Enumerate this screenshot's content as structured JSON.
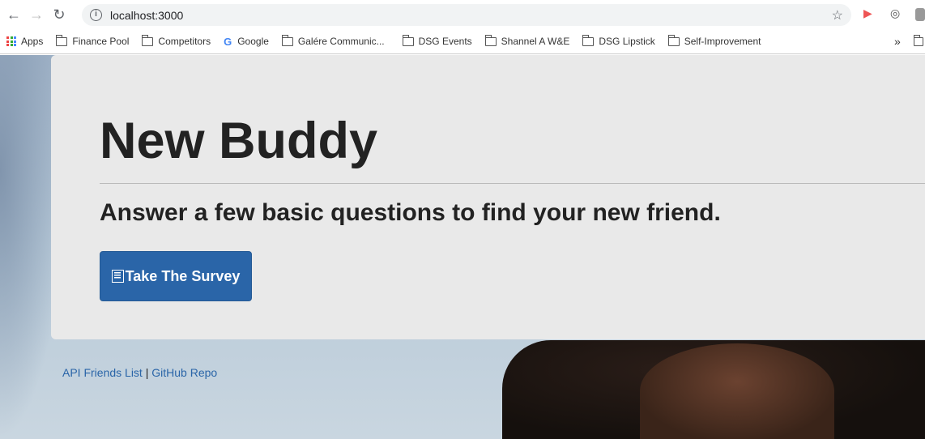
{
  "browser": {
    "url": "localhost:3000"
  },
  "bookmarks": [
    {
      "label": "Apps",
      "icon": "apps-grid-icon"
    },
    {
      "label": "Finance Pool",
      "icon": "folder-icon"
    },
    {
      "label": "Competitors",
      "icon": "folder-icon"
    },
    {
      "label": "Google",
      "icon": "google-icon"
    },
    {
      "label": "Galére Communic...",
      "icon": "folder-icon"
    },
    {
      "label": "DSG Events",
      "icon": "folder-icon"
    },
    {
      "label": "Shannel A W&E",
      "icon": "folder-icon"
    },
    {
      "label": "DSG Lipstick",
      "icon": "folder-icon"
    },
    {
      "label": "Self-Improvement",
      "icon": "folder-icon"
    }
  ],
  "more_label": "»",
  "hero": {
    "title": "New Buddy",
    "subtitle": "Answer a few basic questions to find your new friend.",
    "button_label": "Take The Survey"
  },
  "footer": {
    "link1": "API Friends List",
    "separator": "|",
    "link2": "GitHub Repo"
  },
  "colors": {
    "primary": "#2a65a8",
    "jumbotron": "#e9e9e9"
  }
}
